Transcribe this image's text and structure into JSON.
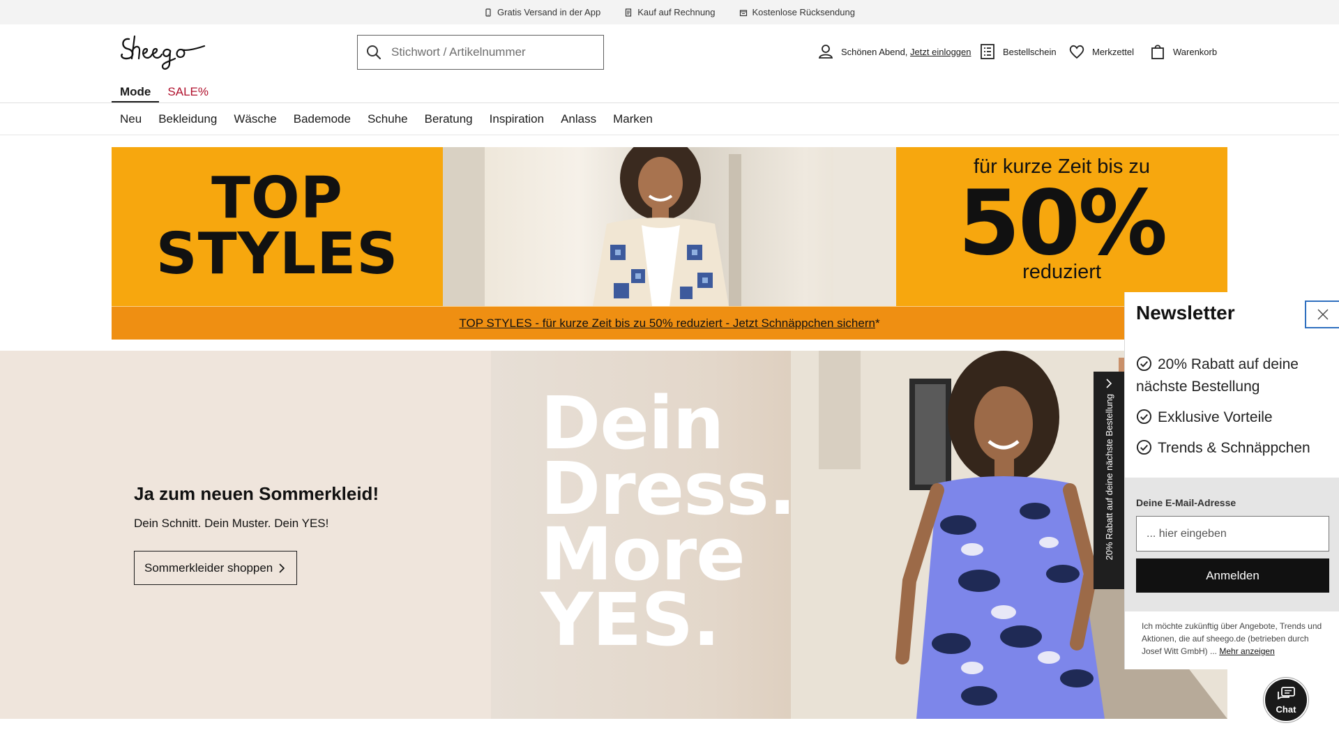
{
  "infobar": {
    "app_shipping": "Gratis Versand in der App",
    "invoice": "Kauf auf Rechnung",
    "free_return": "Kostenlose Rücksendung"
  },
  "header": {
    "logo_text": "Sheego",
    "search_placeholder": "Stichwort / Artikelnummer",
    "greeting": "Schönen Abend,",
    "login_link": "Jetzt einloggen",
    "order_form": "Bestellschein",
    "wishlist": "Merkzettel",
    "cart": "Warenkorb"
  },
  "tabs": [
    {
      "label": "Mode"
    },
    {
      "label": "SALE%"
    }
  ],
  "nav": [
    "Neu",
    "Bekleidung",
    "Wäsche",
    "Bademode",
    "Schuhe",
    "Beratung",
    "Inspiration",
    "Anlass",
    "Marken"
  ],
  "promo": {
    "left_line1": "TOP",
    "left_line2": "STYLES",
    "right_line1": "für kurze Zeit bis zu",
    "right_line2": "50%",
    "right_line3": "reduziert",
    "link_text": "TOP STYLES - für kurze Zeit bis zu 50% reduziert - Jetzt Schnäppchen sichern",
    "link_suffix": "*"
  },
  "hero": {
    "title": "Ja zum neuen Sommerkleid!",
    "subtitle": "Dein Schnitt. Dein Muster. Dein YES!",
    "button": "Sommerkleider shoppen",
    "headline": [
      "Dein",
      "Dress.",
      "More",
      "YES."
    ]
  },
  "side_tab": {
    "label": "20% Rabatt auf deine nächste Bestellung"
  },
  "newsletter": {
    "title": "Newsletter",
    "benefits": [
      "20% Rabatt auf deine nächste Bestellung",
      "Exklusive Vorteile",
      "Trends & Schnäppchen"
    ],
    "email_label": "Deine E-Mail-Adresse",
    "email_placeholder": "... hier eingeben",
    "submit": "Anmelden",
    "legal": "Ich möchte zukünftig über Angebote, Trends und Aktionen, die auf sheego.de (betrieben durch Josef Witt GmbH) ...",
    "more_link": "Mehr anzeigen"
  },
  "chat": {
    "label": "Chat"
  },
  "colors": {
    "promo_orange": "#f7a70e",
    "promo_bar": "#ef8f12",
    "sale_red": "#b0102c",
    "hero_beige": "#efe5dc",
    "focus_blue": "#2f6fbf"
  }
}
